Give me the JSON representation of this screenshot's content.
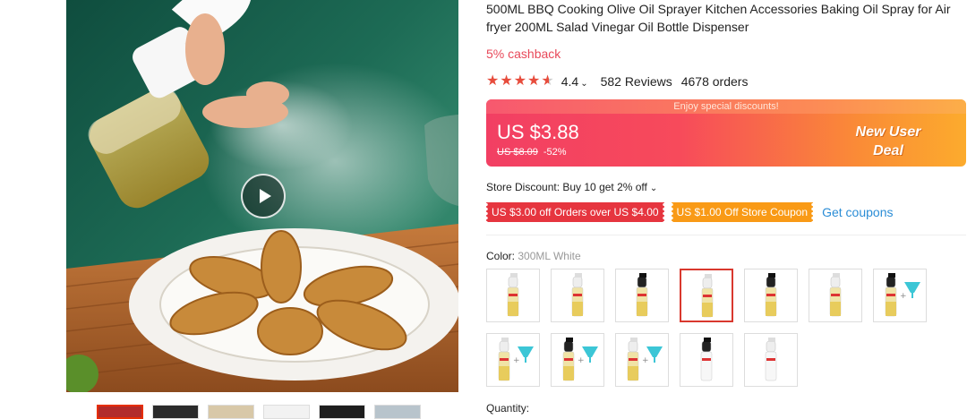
{
  "product": {
    "title": "500ML BBQ Cooking Olive Oil Sprayer Kitchen Accessories Baking Oil Spray for Air fryer 200ML Salad Vinegar Oil Bottle Dispenser",
    "cashback": "5% cashback",
    "rating": {
      "score": "4.4",
      "stars_filled": 4.4,
      "reviews": "582 Reviews",
      "orders": "4678 orders"
    }
  },
  "price_box": {
    "banner": "Enjoy special discounts!",
    "price": "US $3.88",
    "original_price": "US $8.09",
    "discount": "-52%",
    "deal_line1": "New User",
    "deal_line2": "Deal",
    "colors": {
      "start": "#f23f63",
      "end": "#fcab2d"
    }
  },
  "store_discount": {
    "text": "Store Discount: Buy 10 get 2% off"
  },
  "coupons": {
    "items": [
      {
        "label": "US $3.00 off Orders over US $4.00",
        "color": "#e6353f"
      },
      {
        "label": "US $1.00 Off Store Coupon",
        "color": "#f99a16"
      }
    ],
    "get_label": "Get coupons"
  },
  "color_option": {
    "label": "Color:",
    "selected": "300ML White",
    "swatches": [
      {
        "variant": "white-nozzle-gold",
        "selected": false
      },
      {
        "variant": "white-nozzle-gold-tall",
        "selected": false
      },
      {
        "variant": "black-nozzle-gold",
        "selected": false
      },
      {
        "variant": "white-nozzle-gold-300",
        "selected": true
      },
      {
        "variant": "black-nozzle-gold-300",
        "selected": false
      },
      {
        "variant": "white-nozzle-gold-slim",
        "selected": false
      },
      {
        "variant": "black-with-funnel",
        "selected": false
      },
      {
        "variant": "white-with-funnel",
        "selected": false
      },
      {
        "variant": "black-with-funnel-2",
        "selected": false
      },
      {
        "variant": "white-with-funnel-2",
        "selected": false
      },
      {
        "variant": "black-empty",
        "selected": false
      },
      {
        "variant": "white-empty",
        "selected": false
      }
    ]
  },
  "quantity": {
    "label": "Quantity:"
  },
  "gallery": {
    "thumb_count": 6,
    "active_thumb": 0,
    "play_icon": "play-icon"
  }
}
